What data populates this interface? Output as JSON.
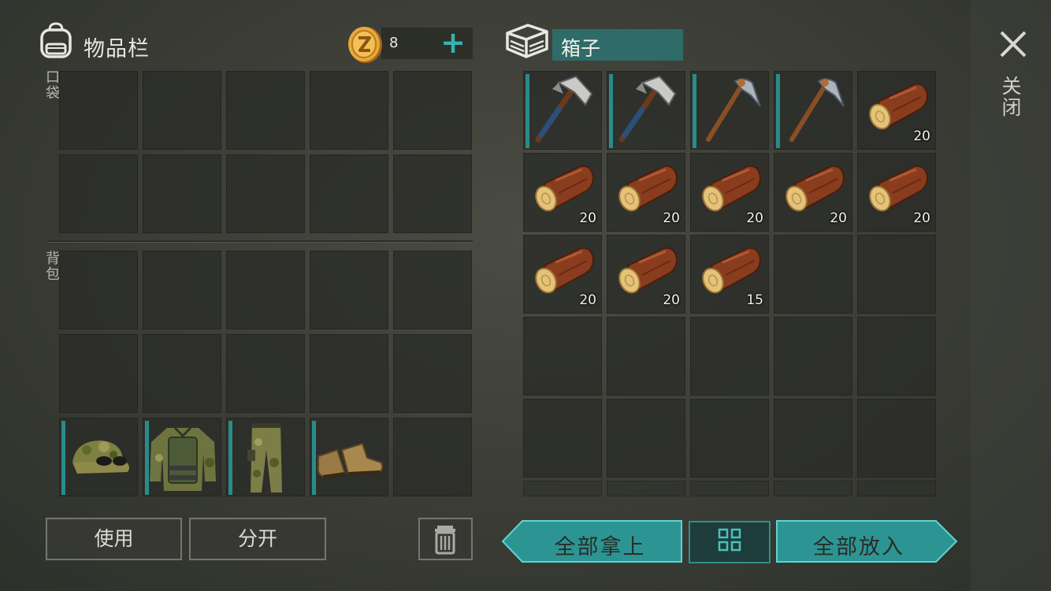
{
  "inventory": {
    "title": "物品栏",
    "coins": "8",
    "pocket_label": "口袋",
    "backpack_label": "背包",
    "equipment": [
      {
        "item": "camo-cap-with-sunglasses"
      },
      {
        "item": "camo-armored-jacket"
      },
      {
        "item": "camo-pants"
      },
      {
        "item": "leather-boots"
      },
      {
        "item": ""
      }
    ]
  },
  "box": {
    "title": "箱子",
    "slots": [
      {
        "item": "hatchet",
        "qty": ""
      },
      {
        "item": "hatchet",
        "qty": ""
      },
      {
        "item": "pickaxe",
        "qty": ""
      },
      {
        "item": "pickaxe",
        "qty": ""
      },
      {
        "item": "log",
        "qty": "20"
      },
      {
        "item": "log",
        "qty": "20"
      },
      {
        "item": "log",
        "qty": "20"
      },
      {
        "item": "log",
        "qty": "20"
      },
      {
        "item": "log",
        "qty": "20"
      },
      {
        "item": "log",
        "qty": "20"
      },
      {
        "item": "log",
        "qty": "20"
      },
      {
        "item": "log",
        "qty": "20"
      },
      {
        "item": "log",
        "qty": "15"
      }
    ]
  },
  "buttons": {
    "use": "使用",
    "split": "分开",
    "take_all": "全部拿上",
    "put_all": "全部放入",
    "close": "关闭"
  },
  "colors": {
    "accent": "#35b3b0",
    "accent_dark": "#2a8c8a",
    "slot": "#2a2c28"
  }
}
